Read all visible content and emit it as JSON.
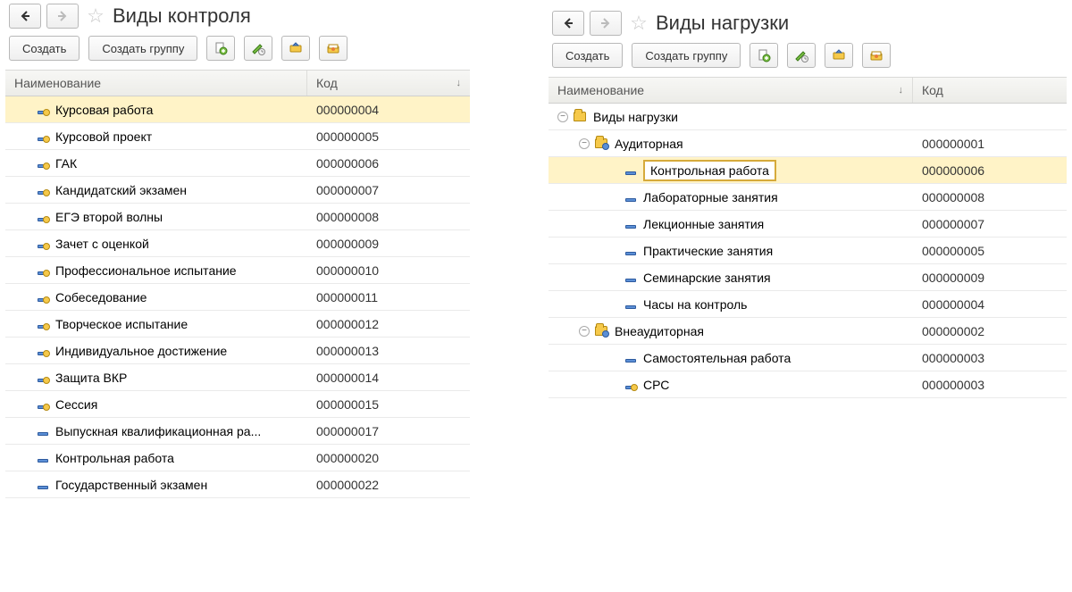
{
  "left": {
    "title": "Виды контроля",
    "create_label": "Создать",
    "create_group_label": "Создать группу",
    "header_name": "Наименование",
    "header_code": "Код",
    "col_name_width": 338,
    "selected_index": 0,
    "rows": [
      {
        "name": "Курсовая работа",
        "code": "000000004",
        "icon": "item-dotted"
      },
      {
        "name": "Курсовой проект",
        "code": "000000005",
        "icon": "item-dotted"
      },
      {
        "name": "ГАК",
        "code": "000000006",
        "icon": "item-dotted"
      },
      {
        "name": "Кандидатский экзамен",
        "code": "000000007",
        "icon": "item-dotted"
      },
      {
        "name": "ЕГЭ второй волны",
        "code": "000000008",
        "icon": "item-dotted"
      },
      {
        "name": "Зачет с оценкой",
        "code": "000000009",
        "icon": "item-dotted"
      },
      {
        "name": "Профессиональное испытание",
        "code": "000000010",
        "icon": "item-dotted"
      },
      {
        "name": "Собеседование",
        "code": "000000011",
        "icon": "item-dotted"
      },
      {
        "name": "Творческое испытание",
        "code": "000000012",
        "icon": "item-dotted"
      },
      {
        "name": "Индивидуальное достижение",
        "code": "000000013",
        "icon": "item-dotted"
      },
      {
        "name": "Защита ВКР",
        "code": "000000014",
        "icon": "item-dotted"
      },
      {
        "name": "Сессия",
        "code": "000000015",
        "icon": "item-dotted"
      },
      {
        "name": "Выпускная квалификационная ра...",
        "code": "000000017",
        "icon": "item"
      },
      {
        "name": "Контрольная работа",
        "code": "000000020",
        "icon": "item"
      },
      {
        "name": "Государственный экзамен",
        "code": "000000022",
        "icon": "item"
      }
    ]
  },
  "right": {
    "title": "Виды нагрузки",
    "create_label": "Создать",
    "create_group_label": "Создать группу",
    "header_name": "Наименование",
    "header_code": "Код",
    "col_name_width": 408,
    "selected_index": 2,
    "rows": [
      {
        "name": "Виды нагрузки",
        "code": "",
        "icon": "folder",
        "indent": 0,
        "toggle": "−"
      },
      {
        "name": "Аудиторная",
        "code": "000000001",
        "icon": "folder-dotted",
        "indent": 1,
        "toggle": "−"
      },
      {
        "name": "Контрольная работа",
        "code": "000000006",
        "icon": "item",
        "indent": 2,
        "editing": true
      },
      {
        "name": "Лабораторные занятия",
        "code": "000000008",
        "icon": "item",
        "indent": 2
      },
      {
        "name": "Лекционные занятия",
        "code": "000000007",
        "icon": "item",
        "indent": 2
      },
      {
        "name": "Практические занятия",
        "code": "000000005",
        "icon": "item",
        "indent": 2
      },
      {
        "name": "Семинарские занятия",
        "code": "000000009",
        "icon": "item",
        "indent": 2
      },
      {
        "name": "Часы на контроль",
        "code": "000000004",
        "icon": "item",
        "indent": 2
      },
      {
        "name": "Внеаудиторная",
        "code": "000000002",
        "icon": "folder-dotted",
        "indent": 1,
        "toggle": "−"
      },
      {
        "name": "Самостоятельная работа",
        "code": "000000003",
        "icon": "item",
        "indent": 2
      },
      {
        "name": "СРС",
        "code": "000000003",
        "icon": "item-dotted",
        "indent": 2
      }
    ]
  }
}
